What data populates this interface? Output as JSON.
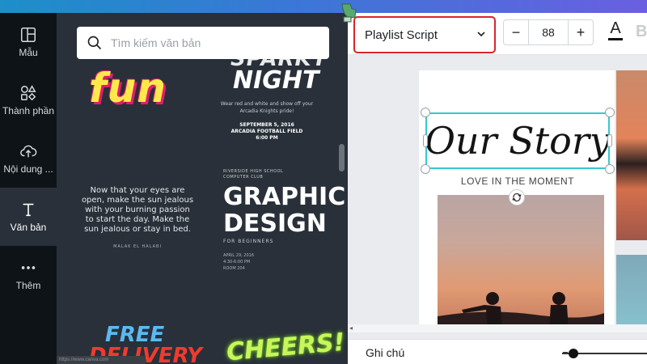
{
  "sidebar": {
    "items": [
      {
        "label": "Mẫu",
        "icon": "template-icon"
      },
      {
        "label": "Thành phần",
        "icon": "elements-icon"
      },
      {
        "label": "Nội dung ...",
        "icon": "upload-icon"
      },
      {
        "label": "Văn bản",
        "icon": "text-icon",
        "active": true
      },
      {
        "label": "Thêm",
        "icon": "more-icon"
      }
    ]
  },
  "panel": {
    "search_placeholder": "Tìm kiếm văn bản",
    "samples": {
      "fun": "fun",
      "sparky": "SPARKY",
      "night": "NIGHT",
      "night_desc": "Wear red and white and show off your Arcadia Knights pride!",
      "night_date": "SEPTEMBER 5, 2016",
      "night_place": "ARCADIA FOOTBALL FIELD",
      "night_time": "6:00 PM",
      "quote": "Now that your eyes are open, make the sun jealous with your burning passion to start the day. Make the sun jealous or stay in bed.",
      "quote_author": "MALAK EL HALABI",
      "school": "RIVERSIDE HIGH SCHOOL",
      "club": "COMPUTER CLUB",
      "graphic": "GRAPHIC",
      "design": "DESIGN",
      "beginners": "FOR BEGINNERS",
      "date1": "APRIL 29, 2016",
      "date2": "4:30-6:00 PM",
      "date3": "ROOM 204",
      "free": "FREE",
      "delivery": "DELIVERY",
      "cheers": "CHEERS!"
    },
    "status_url": "https://www.canva.com"
  },
  "toolbar": {
    "font_name": "Playlist Script",
    "font_size": "88",
    "minus": "−",
    "plus": "+",
    "text_color_label": "A",
    "bold_label": "B",
    "highlight_color": "#d9252b"
  },
  "canvas": {
    "title": "Our Story",
    "subtitle": "LOVE IN THE MOMENT",
    "selection_color": "#38c7d1"
  },
  "bottom": {
    "notes_label": "Ghi chú"
  }
}
